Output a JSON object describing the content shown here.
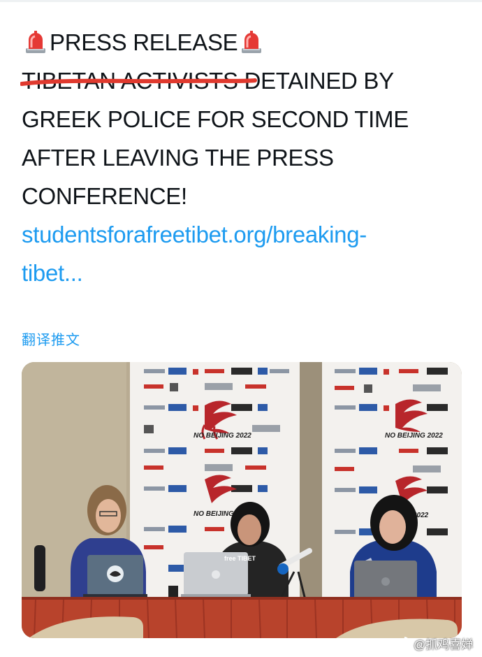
{
  "tweet": {
    "title": "PRESS RELEASE",
    "struck_text": "TIBETAN ACTIVISTS",
    "body_line_1": "DETAINED BY",
    "body_line_2": "GREEK POLICE FOR SECOND TIME",
    "body_line_3": "AFTER LEAVING THE PRESS",
    "body_line_4": "CONFERENCE!",
    "link_line_1": "studentsforafreetibet.org/breaking-",
    "link_line_2": "tibet...",
    "translate_label": "翻译推文",
    "siren_icon": "police-siren-emoji"
  },
  "photo": {
    "banner_text": "NO BEIJING 2022",
    "banner_logo_free_tibet": "free TIBET",
    "laptop_sticker": "free TIBET"
  },
  "watermark": {
    "text": "@抓鸡喜婵",
    "icon": "weibo-logo"
  },
  "colors": {
    "link": "#1d9bf0",
    "strike": "#e03a2f",
    "tablecloth": "#b8432c",
    "backdrop": "#f3f1ee"
  }
}
